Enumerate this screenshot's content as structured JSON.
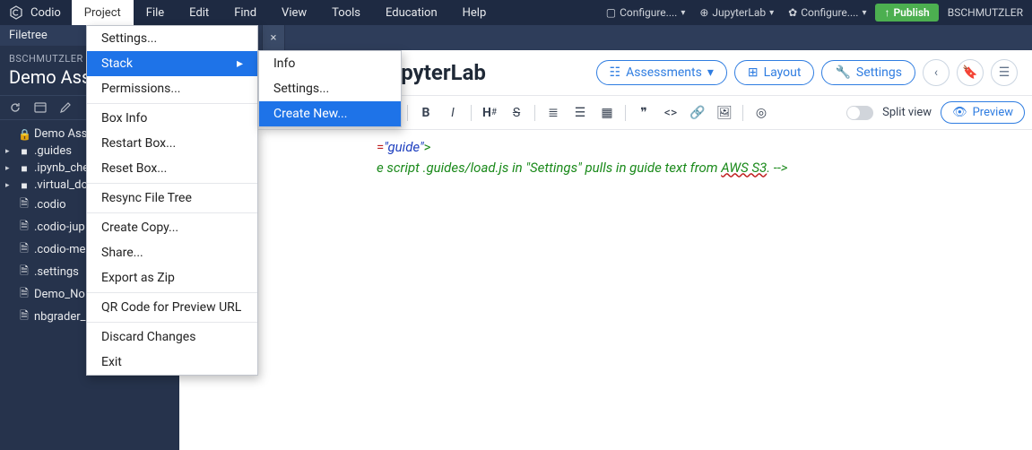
{
  "app": {
    "name": "Codio",
    "user": "BSCHMUTZLER"
  },
  "menubar": {
    "items": [
      "Codio",
      "Project",
      "File",
      "Edit",
      "Find",
      "View",
      "Tools",
      "Education",
      "Help"
    ],
    "active": "Project",
    "right": {
      "configure1": "Configure....",
      "jupyter": "JupyterLab",
      "configure2": "Configure....",
      "publish": "Publish"
    }
  },
  "sidebar": {
    "filetree_label": "Filetree",
    "breadcrumb": "BSCHMUTZLER",
    "title": "Demo Assi",
    "items": [
      {
        "icon": "lock",
        "label": "Demo Assign",
        "caret": ""
      },
      {
        "icon": "folder",
        "label": ".guides",
        "caret": "▸"
      },
      {
        "icon": "folder",
        "label": ".ipynb_che",
        "caret": "▸"
      },
      {
        "icon": "folder",
        "label": ".virtual_do",
        "caret": "▸"
      },
      {
        "icon": "file",
        "label": ".codio",
        "caret": ""
      },
      {
        "icon": "file",
        "label": ".codio-jup",
        "caret": ""
      },
      {
        "icon": "file",
        "label": ".codio-me",
        "caret": ""
      },
      {
        "icon": "file",
        "label": ".settings",
        "caret": ""
      },
      {
        "icon": "file",
        "label": "Demo_No",
        "caret": ""
      },
      {
        "icon": "file",
        "label": "nbgrader_",
        "caret": ""
      }
    ]
  },
  "guide": {
    "title_fragment": "oks in JupyterLab",
    "assessments": "Assessments",
    "layout": "Layout",
    "settings": "Settings",
    "splitview": "Split view",
    "preview": "Preview"
  },
  "code": {
    "line1_attr": "=",
    "line1_val": "\"guide\"",
    "line1_tail": ">",
    "line2_pre": "e script .guides/load.js in \"Settings\" pulls in guide text from ",
    "line2_u": "AWS S3",
    "line2_post": ". -->"
  },
  "project_menu": {
    "items": [
      "Settings...",
      "Stack",
      "Permissions...",
      "Box Info",
      "Restart Box...",
      "Reset Box...",
      "Resync File Tree",
      "Create Copy...",
      "Share...",
      "Export as Zip",
      "QR Code for Preview URL",
      "Discard Changes",
      "Exit"
    ],
    "highlight": "Stack"
  },
  "stack_submenu": {
    "items": [
      "Info",
      "Settings...",
      "Create New..."
    ],
    "highlight": "Create New..."
  }
}
